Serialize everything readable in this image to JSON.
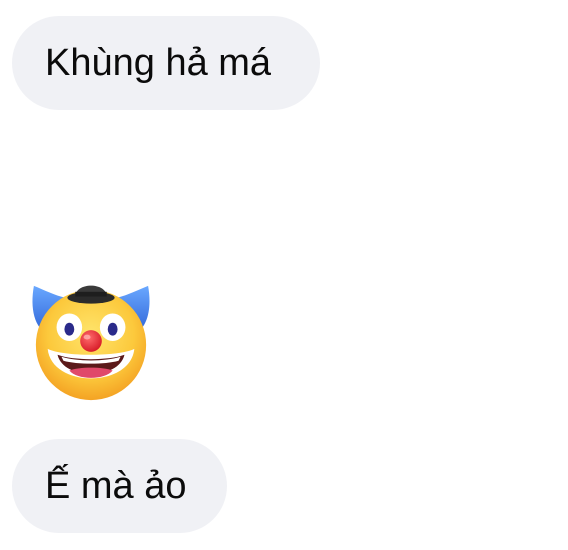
{
  "messages": [
    {
      "type": "text",
      "text": "Khùng hả má"
    },
    {
      "type": "emoji",
      "icon": "clown-face-emoji"
    },
    {
      "type": "text",
      "text": "Ế mà ảo"
    }
  ],
  "colors": {
    "bubble_bg": "#f0f1f5",
    "text": "#0b0b0b"
  }
}
